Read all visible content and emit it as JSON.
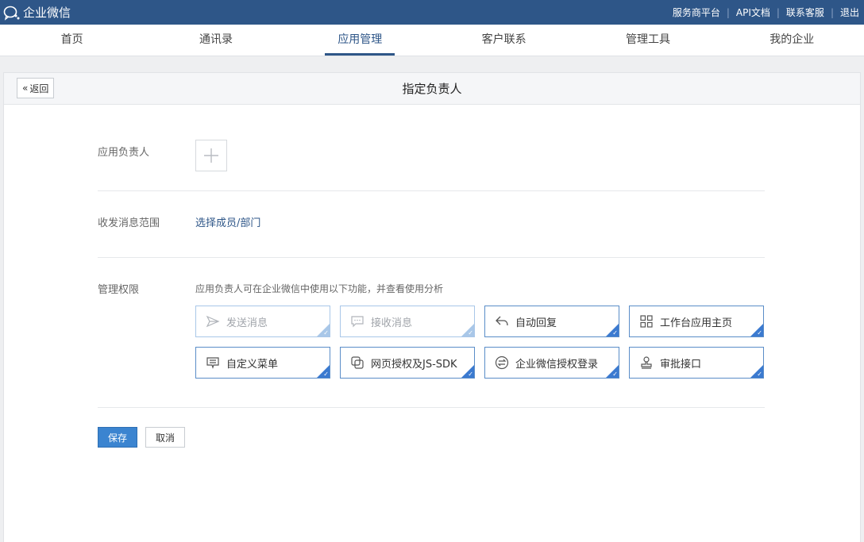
{
  "topbar": {
    "brand": "企业微信",
    "links": [
      "服务商平台",
      "API文档",
      "联系客服",
      "退出"
    ]
  },
  "nav": {
    "items": [
      "首页",
      "通讯录",
      "应用管理",
      "客户联系",
      "管理工具",
      "我的企业"
    ],
    "active_index": 2
  },
  "panel": {
    "back_label": "返回",
    "title": "指定负责人"
  },
  "form": {
    "owner_label": "应用负责人",
    "scope_label": "收发消息范围",
    "scope_link": "选择成员/部门",
    "perm_label": "管理权限",
    "perm_desc": "应用负责人可在企业微信中使用以下功能，并查看使用分析",
    "permissions": [
      {
        "label": "发送消息",
        "icon": "send-icon",
        "enabled": false
      },
      {
        "label": "接收消息",
        "icon": "message-icon",
        "enabled": false
      },
      {
        "label": "自动回复",
        "icon": "reply-icon",
        "enabled": true
      },
      {
        "label": "工作台应用主页",
        "icon": "grid-icon",
        "enabled": true
      },
      {
        "label": "自定义菜单",
        "icon": "menu-icon",
        "enabled": true
      },
      {
        "label": "网页授权及JS-SDK",
        "icon": "web-auth-icon",
        "enabled": true
      },
      {
        "label": "企业微信授权登录",
        "icon": "login-auth-icon",
        "enabled": true
      },
      {
        "label": "审批接口",
        "icon": "stamp-icon",
        "enabled": true
      }
    ],
    "save_label": "保存",
    "cancel_label": "取消"
  },
  "colors": {
    "topbar": "#2e5688",
    "accent": "#3b84d0",
    "link": "#2e5688"
  }
}
